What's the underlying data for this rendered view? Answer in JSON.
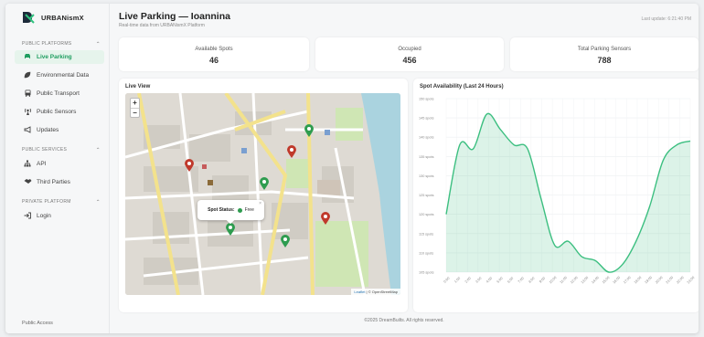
{
  "brand": {
    "name": "URBANismX"
  },
  "sidebar": {
    "sections": [
      {
        "title": "PUBLIC PLATFORMS",
        "items": [
          {
            "label": "Live Parking",
            "icon": "car-icon",
            "active": true
          },
          {
            "label": "Environmental Data",
            "icon": "leaf-icon"
          },
          {
            "label": "Public Transport",
            "icon": "bus-icon"
          },
          {
            "label": "Public Sensors",
            "icon": "sensor-icon"
          },
          {
            "label": "Updates",
            "icon": "megaphone-icon"
          }
        ]
      },
      {
        "title": "PUBLIC SERVICES",
        "items": [
          {
            "label": "API",
            "icon": "sitemap-icon"
          },
          {
            "label": "Third Parties",
            "icon": "handshake-icon"
          }
        ]
      },
      {
        "title": "PRIVATE PLATFORM",
        "items": [
          {
            "label": "Login",
            "icon": "login-icon"
          }
        ]
      }
    ],
    "footer": "Public Access"
  },
  "header": {
    "title": "Live Parking — Ioannina",
    "subtitle": "Real-time data from URBANismX Platform",
    "last_update": "Last update: 6:21:40 PM"
  },
  "stats": [
    {
      "label": "Available Spots",
      "value": "46"
    },
    {
      "label": "Occupied",
      "value": "456"
    },
    {
      "label": "Total Parking Sensors",
      "value": "788"
    }
  ],
  "map": {
    "title": "Live View",
    "zoom_in": "+",
    "zoom_out": "−",
    "popup": {
      "label": "Spot Status:",
      "status": "Free",
      "close": "×"
    },
    "attribution_leaflet": "Leaflet",
    "attribution_rest": " | © OpenStreetMap",
    "colors": {
      "free": "#2e9c4f",
      "occupied": "#c0392b"
    }
  },
  "chart_data": {
    "type": "area",
    "title": "Spot Availability (Last 24 Hours)",
    "xlabel": "",
    "ylabel": "",
    "ylim": [
      105,
      150
    ],
    "y_ticks": [
      150,
      145,
      140,
      135,
      130,
      125,
      120,
      115,
      110,
      105
    ],
    "y_tick_suffix": " spots",
    "x": [
      "0:00",
      "1:00",
      "2:00",
      "3:00",
      "4:00",
      "5:00",
      "6:00",
      "7:00",
      "8:00",
      "9:00",
      "10:00",
      "11:00",
      "12:00",
      "13:00",
      "14:00",
      "15:00",
      "16:00",
      "17:00",
      "18:00",
      "19:00",
      "20:00",
      "21:00",
      "22:00",
      "23:00"
    ],
    "values": [
      120,
      138,
      137,
      146,
      142,
      138,
      137,
      124,
      112,
      113,
      109,
      108,
      105,
      107,
      113,
      122,
      134,
      138,
      139
    ],
    "grid": true,
    "color": "#3cbf80"
  },
  "footer": {
    "copyright": "©2025 DreamBuilts. All rights reserved."
  }
}
